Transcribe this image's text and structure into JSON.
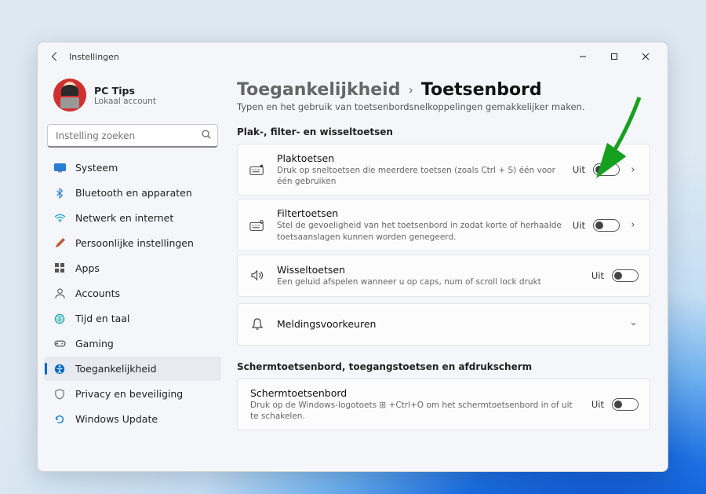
{
  "window": {
    "title": "Instellingen"
  },
  "profile": {
    "name": "PC Tips",
    "subtitle": "Lokaal account"
  },
  "search": {
    "placeholder": "Instelling zoeken"
  },
  "nav": {
    "items": [
      {
        "label": "Systeem",
        "icon_color": "#0078d4"
      },
      {
        "label": "Bluetooth en apparaten",
        "icon_color": "#333"
      },
      {
        "label": "Netwerk en internet",
        "icon_color": "#0099dd"
      },
      {
        "label": "Persoonlijke instellingen",
        "icon_color": "#b05030"
      },
      {
        "label": "Apps",
        "icon_color": "#555"
      },
      {
        "label": "Accounts",
        "icon_color": "#666"
      },
      {
        "label": "Tijd en taal",
        "icon_color": "#0aa"
      },
      {
        "label": "Gaming",
        "icon_color": "#555"
      },
      {
        "label": "Toegankelijkheid",
        "icon_color": "#0067c0"
      },
      {
        "label": "Privacy en beveiliging",
        "icon_color": "#666"
      },
      {
        "label": "Windows Update",
        "icon_color": "#0078d4"
      }
    ]
  },
  "main": {
    "breadcrumb_parent": "Toegankelijkheid",
    "breadcrumb_current": "Toetsenbord",
    "subtitle": "Typen en het gebruik van toetsenbordsnelkoppelingen gemakkelijker maken.",
    "section1_label": "Plak-, filter- en wisseltoetsen",
    "section2_label": "Schermtoetsenbord, toegangstoetsen en afdrukscherm",
    "cards": {
      "plak": {
        "title": "Plaktoetsen",
        "desc": "Druk op sneltoetsen die meerdere toetsen (zoals Ctrl + S) één voor één gebruiken",
        "state": "Uit"
      },
      "filter": {
        "title": "Filtertoetsen",
        "desc": "Stel de gevoeligheid van het toetsenbord in zodat korte of herhaalde toetsaanslagen kunnen worden genegeerd.",
        "state": "Uit"
      },
      "wissel": {
        "title": "Wisseltoetsen",
        "desc": "Een geluid afspelen wanneer u op caps, num of scroll lock drukt",
        "state": "Uit"
      },
      "meldingen": {
        "title": "Meldingsvoorkeuren"
      },
      "scherm": {
        "title": "Schermtoetsenbord",
        "desc": "Druk op de Windows-logotoets ⊞ +Ctrl+O om het schermtoetsenbord in of uit te schakelen.",
        "state": "Uit"
      }
    }
  }
}
